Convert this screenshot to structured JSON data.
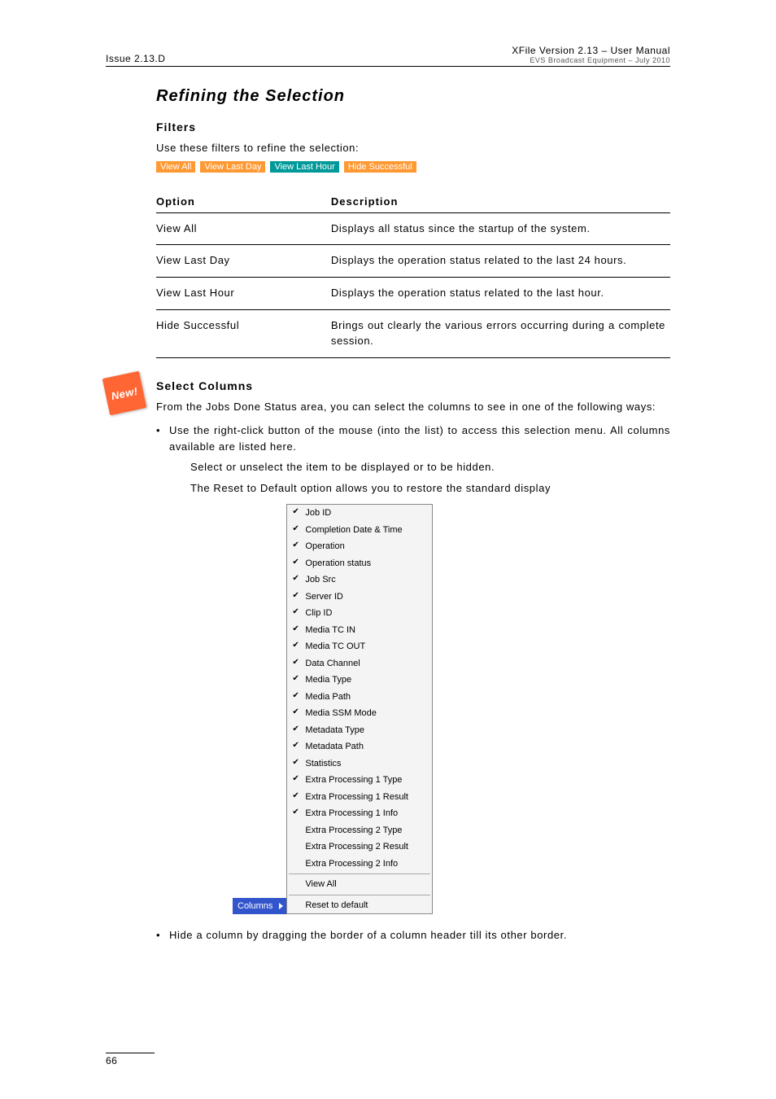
{
  "header": {
    "left": "Issue 2.13.D",
    "right_main": "XFile Version 2.13 – User Manual",
    "right_sub": "EVS Broadcast Equipment – July 2010"
  },
  "h2": "Refining the Selection",
  "filters": {
    "heading": "Filters",
    "intro": "Use these filters to refine the selection:",
    "buttons": [
      "View All",
      "View Last Day",
      "View Last Hour",
      "Hide Successful"
    ]
  },
  "options_table": {
    "head": [
      "Option",
      "Description"
    ],
    "rows": [
      [
        "View All",
        "Displays all status since the startup of the system."
      ],
      [
        "View Last Day",
        "Displays the operation status related to the last 24 hours."
      ],
      [
        "View Last Hour",
        "Displays the operation status related to the last hour."
      ],
      [
        "Hide Successful",
        "Brings out clearly the various errors occurring during a complete session."
      ]
    ]
  },
  "new_badge": "New!",
  "select_cols": {
    "heading": "Select Columns",
    "intro": "From the Jobs Done Status area, you can select the columns to see in one of the following ways:",
    "bullet1": "Use the right-click button of the mouse (into the list) to access this selection menu. All columns available are listed here.",
    "sub1": "Select or unselect the item to be displayed or to be hidden.",
    "sub2": "The Reset to Default option allows you to restore the standard display",
    "bullet2": "Hide a column by dragging the border of a column header till its other border."
  },
  "columns_button": "Columns",
  "context_menu": {
    "items": [
      {
        "label": "Job ID",
        "checked": true
      },
      {
        "label": "Completion Date & Time",
        "checked": true
      },
      {
        "label": "Operation",
        "checked": true
      },
      {
        "label": "Operation status",
        "checked": true
      },
      {
        "label": "Job Src",
        "checked": true
      },
      {
        "label": "Server ID",
        "checked": true
      },
      {
        "label": "Clip ID",
        "checked": true
      },
      {
        "label": "Media TC IN",
        "checked": true
      },
      {
        "label": "Media TC OUT",
        "checked": true
      },
      {
        "label": "Data Channel",
        "checked": true
      },
      {
        "label": "Media Type",
        "checked": true
      },
      {
        "label": "Media Path",
        "checked": true
      },
      {
        "label": "Media SSM Mode",
        "checked": true
      },
      {
        "label": "Metadata Type",
        "checked": true
      },
      {
        "label": "Metadata Path",
        "checked": true
      },
      {
        "label": "Statistics",
        "checked": true
      },
      {
        "label": "Extra Processing 1 Type",
        "checked": true
      },
      {
        "label": "Extra Processing 1 Result",
        "checked": true
      },
      {
        "label": "Extra Processing 1 Info",
        "checked": true
      },
      {
        "label": "Extra Processing 2 Type",
        "checked": false
      },
      {
        "label": "Extra Processing 2 Result",
        "checked": false
      },
      {
        "label": "Extra Processing 2 Info",
        "checked": false
      }
    ],
    "view_all": "View All",
    "reset": "Reset to default"
  },
  "page_number": "66",
  "chart_data": {
    "type": "table",
    "title": "Filter options",
    "columns": [
      "Option",
      "Description"
    ],
    "rows": [
      [
        "View All",
        "Displays all status since the startup of the system."
      ],
      [
        "View Last Day",
        "Displays the operation status related to the last 24 hours."
      ],
      [
        "View Last Hour",
        "Displays the operation status related to the last hour."
      ],
      [
        "Hide Successful",
        "Brings out clearly the various errors occurring during a complete session."
      ]
    ]
  }
}
